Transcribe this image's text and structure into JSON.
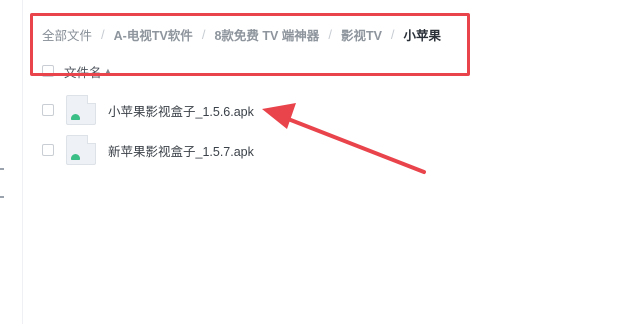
{
  "breadcrumb": {
    "items": [
      "全部文件",
      "A-电视TV软件",
      "8款免费 TV 端神器",
      "影视TV",
      "小苹果"
    ],
    "separator": "/"
  },
  "list_header": {
    "name_column": "文件名",
    "sort_icon": "sort-up-icon"
  },
  "files": [
    {
      "name": "小苹果影视盒子_1.5.6.apk",
      "icon": "apk-file-icon",
      "selected": false
    },
    {
      "name": "新苹果影视盒子_1.5.7.apk",
      "icon": "apk-file-icon",
      "selected": false
    }
  ],
  "annotation": {
    "color": "#e9434b"
  }
}
